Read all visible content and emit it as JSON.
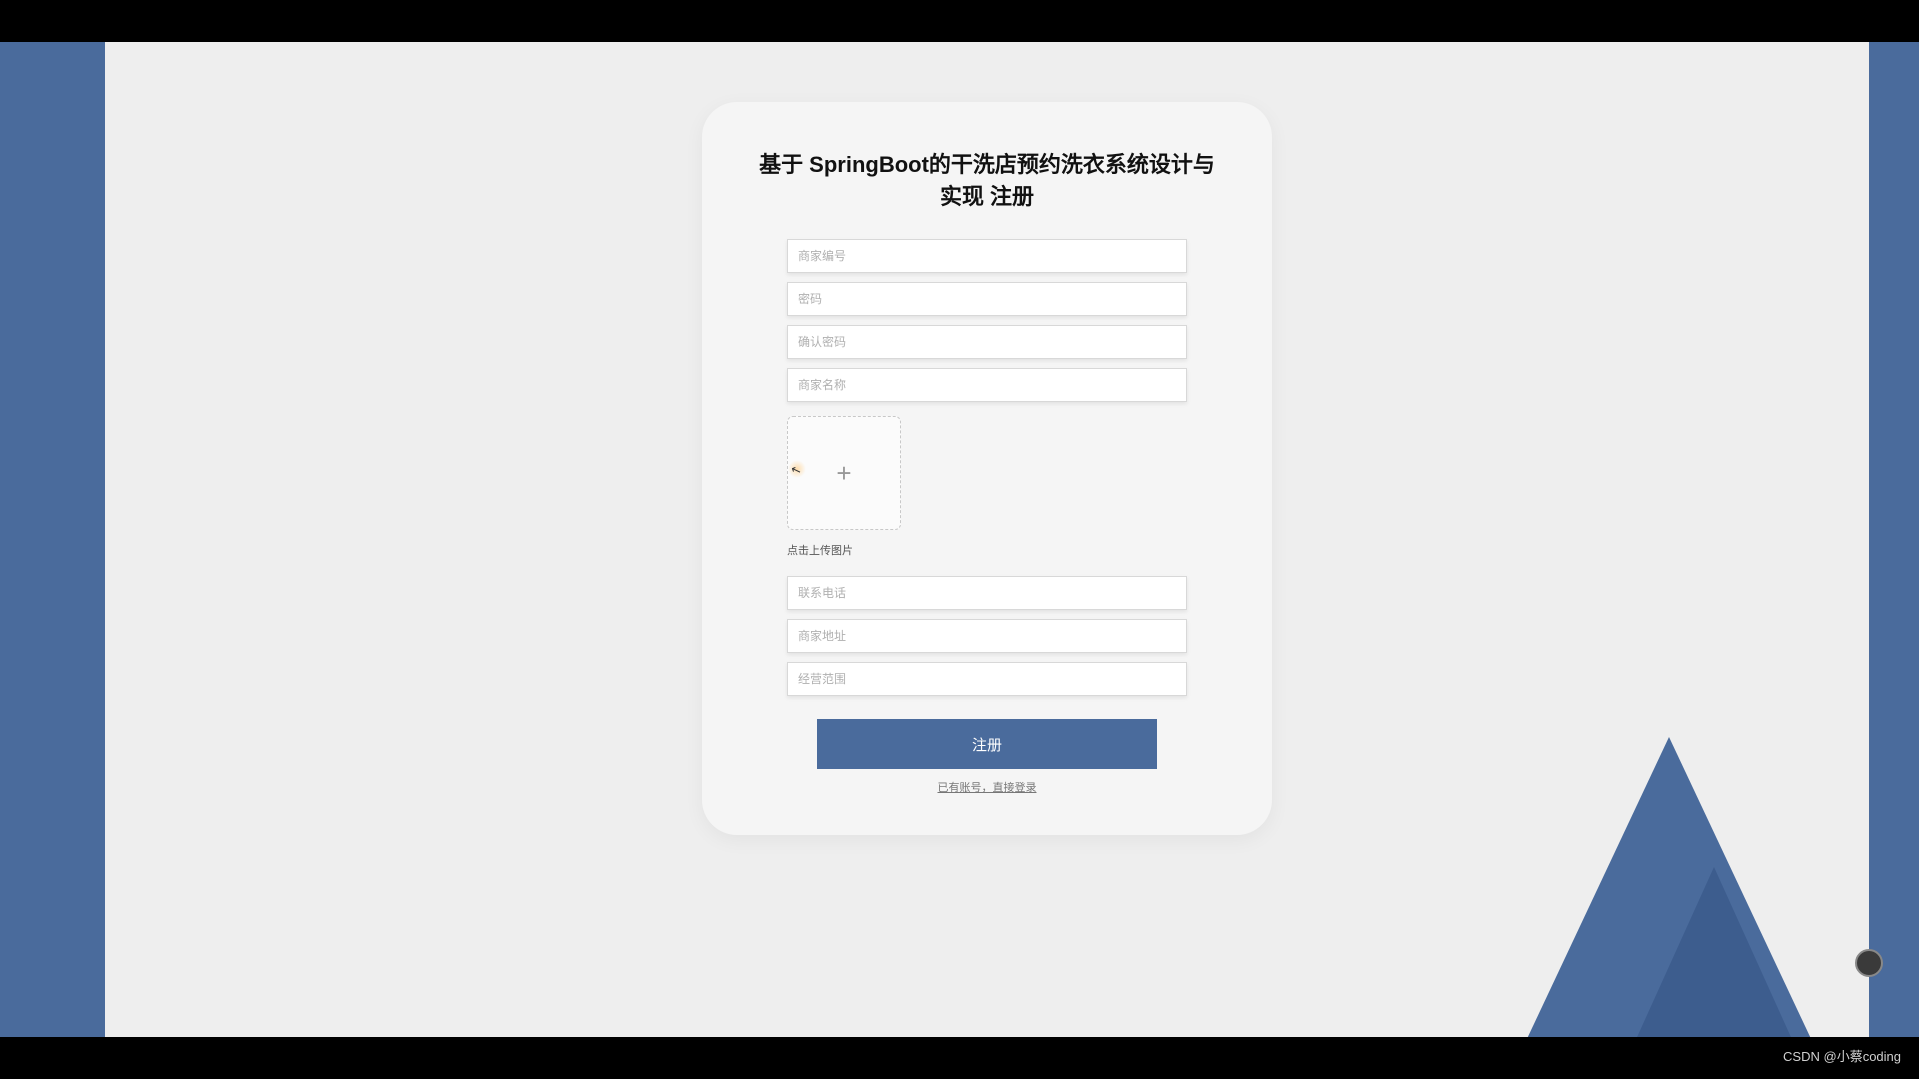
{
  "title": "基于 SpringBoot的干洗店预约洗衣系统设计与实现 注册",
  "fields": {
    "merchant_id": {
      "placeholder": "商家编号",
      "value": ""
    },
    "password": {
      "placeholder": "密码",
      "value": ""
    },
    "confirm_password": {
      "placeholder": "确认密码",
      "value": ""
    },
    "merchant_name": {
      "placeholder": "商家名称",
      "value": ""
    },
    "phone": {
      "placeholder": "联系电话",
      "value": ""
    },
    "address": {
      "placeholder": "商家地址",
      "value": ""
    },
    "business_scope": {
      "placeholder": "经营范围",
      "value": ""
    }
  },
  "upload": {
    "hint": "点击上传图片"
  },
  "buttons": {
    "submit": "注册",
    "login_link": "已有账号，直接登录"
  },
  "watermark": "CSDN @小蔡coding"
}
